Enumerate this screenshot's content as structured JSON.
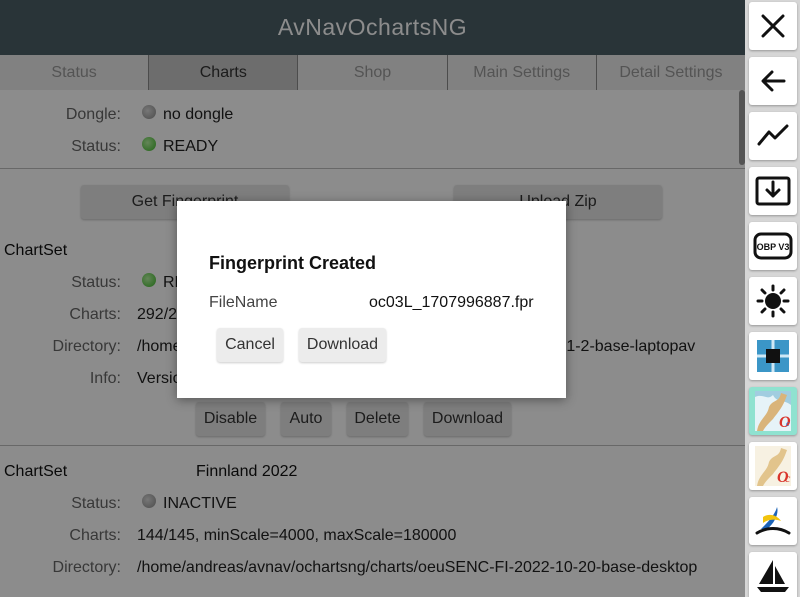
{
  "app": {
    "title": "AvNavOchartsNG"
  },
  "tabs": [
    {
      "label": "Status",
      "active": false
    },
    {
      "label": "Charts",
      "active": true
    },
    {
      "label": "Shop",
      "active": false
    },
    {
      "label": "Main Settings",
      "active": false
    },
    {
      "label": "Detail Settings",
      "active": false
    }
  ],
  "status_section": {
    "dongle_label": "Dongle:",
    "dongle_value": "no dongle",
    "status_label": "Status:",
    "status_value": "READY"
  },
  "actions": {
    "fingerprint_label": "Get Fingerprint",
    "upload_label": "Upload Zip"
  },
  "chartset1": {
    "heading": "ChartSet",
    "status_label": "Status:",
    "status_value": "RE",
    "charts_label": "Charts:",
    "charts_value": "292/2",
    "directory_label": "Directory:",
    "directory_value": "/home",
    "directory_tail": "-1-2-base-laptopav",
    "info_label": "Info:",
    "info_value": "Versio",
    "buttons": {
      "disable": "Disable",
      "auto": "Auto",
      "delete": "Delete",
      "download": "Download"
    }
  },
  "chartset2": {
    "heading": "ChartSet",
    "name": "Finnland 2022",
    "status_label": "Status:",
    "status_value": "INACTIVE",
    "charts_label": "Charts:",
    "charts_value": "144/145, minScale=4000, maxScale=180000",
    "directory_label": "Directory:",
    "directory_value": "/home/andreas/avnav/ochartsng/charts/oeuSENC-FI-2022-10-20-base-desktop"
  },
  "dialog": {
    "title": "Fingerprint Created",
    "filename_label": "FileName",
    "filename_value": "oc03L_1707996887.fpr",
    "cancel_label": "Cancel",
    "download_label": "Download"
  },
  "sidebar": {
    "buttons": [
      {
        "icon": "close-icon"
      },
      {
        "icon": "back-arrow-icon"
      },
      {
        "icon": "chart-line-icon"
      },
      {
        "icon": "download-box-icon"
      },
      {
        "icon": "obp-v3-icon",
        "text": "OBP V3"
      },
      {
        "icon": "brightness-icon"
      },
      {
        "icon": "layers-icon"
      },
      {
        "icon": "ocharts-active-icon",
        "active": true
      },
      {
        "icon": "ocharts-icon"
      },
      {
        "icon": "avnav-logo-icon"
      },
      {
        "icon": "sailboat-icon"
      }
    ]
  },
  "colors": {
    "titlebar": "#4b5f67",
    "active_tab": "#c6c6c6",
    "status_ready": "#3db829",
    "sidebar_active": "#8fe2d0"
  }
}
